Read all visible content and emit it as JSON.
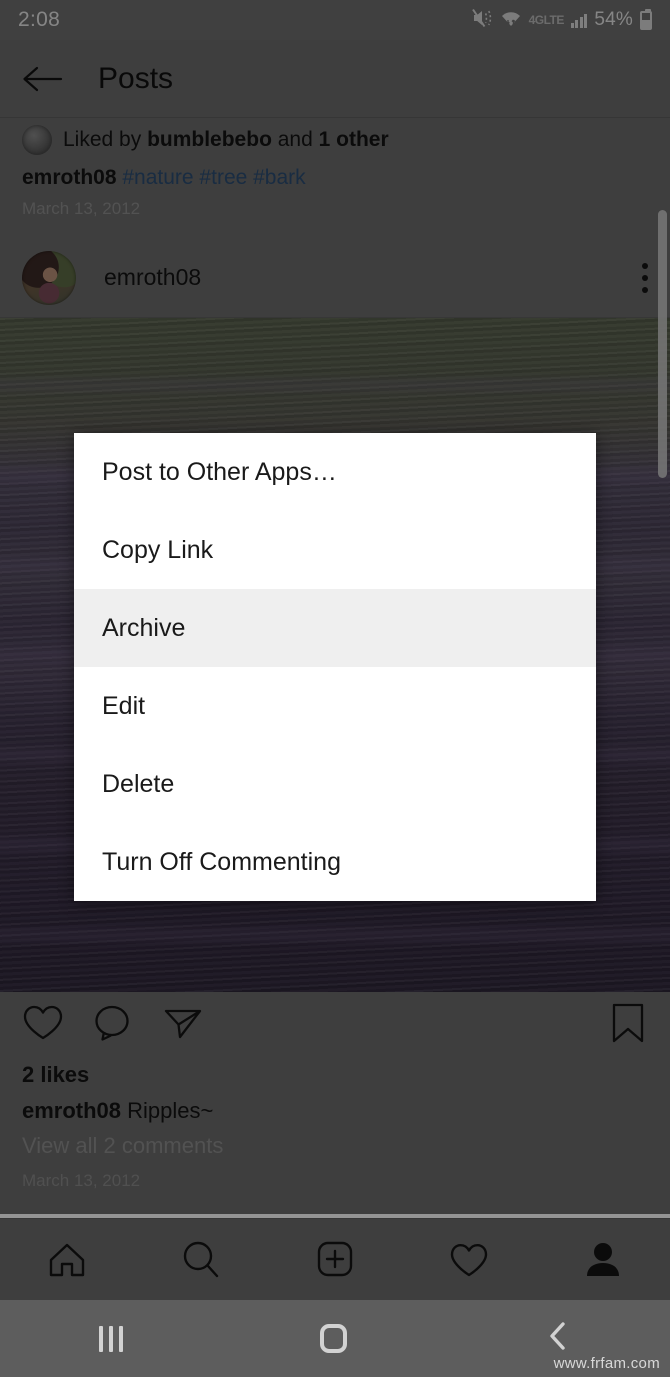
{
  "status_bar": {
    "time": "2:08",
    "battery_percent": "54%",
    "network_label": "4G",
    "network_sub": "LTE",
    "icons": [
      "mute-icon",
      "wifi-icon",
      "lte-icon",
      "signal-bars-icon",
      "battery-icon"
    ]
  },
  "app_header": {
    "back_icon": "back-arrow-icon",
    "title": "Posts"
  },
  "previous_post": {
    "liked_by_prefix": "Liked by ",
    "liked_by_user": "bumblebebo",
    "liked_by_middle": " and ",
    "liked_by_others": "1 other",
    "caption_user": "emroth08",
    "caption_tags": "#nature #tree #bark",
    "date": "March 13, 2012"
  },
  "post": {
    "username": "emroth08",
    "avatar": "user-avatar",
    "menu_icon": "more-options-icon",
    "photo_alt": "water-ripples-photo",
    "likes": "2 likes",
    "caption_user": "emroth08",
    "caption_text": " Ripples~",
    "view_comments": "View all 2 comments",
    "date": "March 13, 2012",
    "actions": {
      "like": "heart-icon",
      "comment": "comment-icon",
      "share": "share-icon",
      "save": "bookmark-icon"
    }
  },
  "options_menu": {
    "items": [
      {
        "label": "Post to Other Apps…",
        "highlighted": false
      },
      {
        "label": "Copy Link",
        "highlighted": false
      },
      {
        "label": "Archive",
        "highlighted": true
      },
      {
        "label": "Edit",
        "highlighted": false
      },
      {
        "label": "Delete",
        "highlighted": false
      },
      {
        "label": "Turn Off Commenting",
        "highlighted": false
      }
    ],
    "highlight_color": "#efefef"
  },
  "tab_bar": {
    "items": [
      {
        "name": "home-icon"
      },
      {
        "name": "search-icon"
      },
      {
        "name": "add-post-icon"
      },
      {
        "name": "activity-heart-icon"
      },
      {
        "name": "profile-icon"
      }
    ]
  },
  "android_nav": {
    "recents": "recents-icon",
    "home": "home-button-icon",
    "back": "back-button-icon"
  },
  "watermark": "www.frfam.com"
}
